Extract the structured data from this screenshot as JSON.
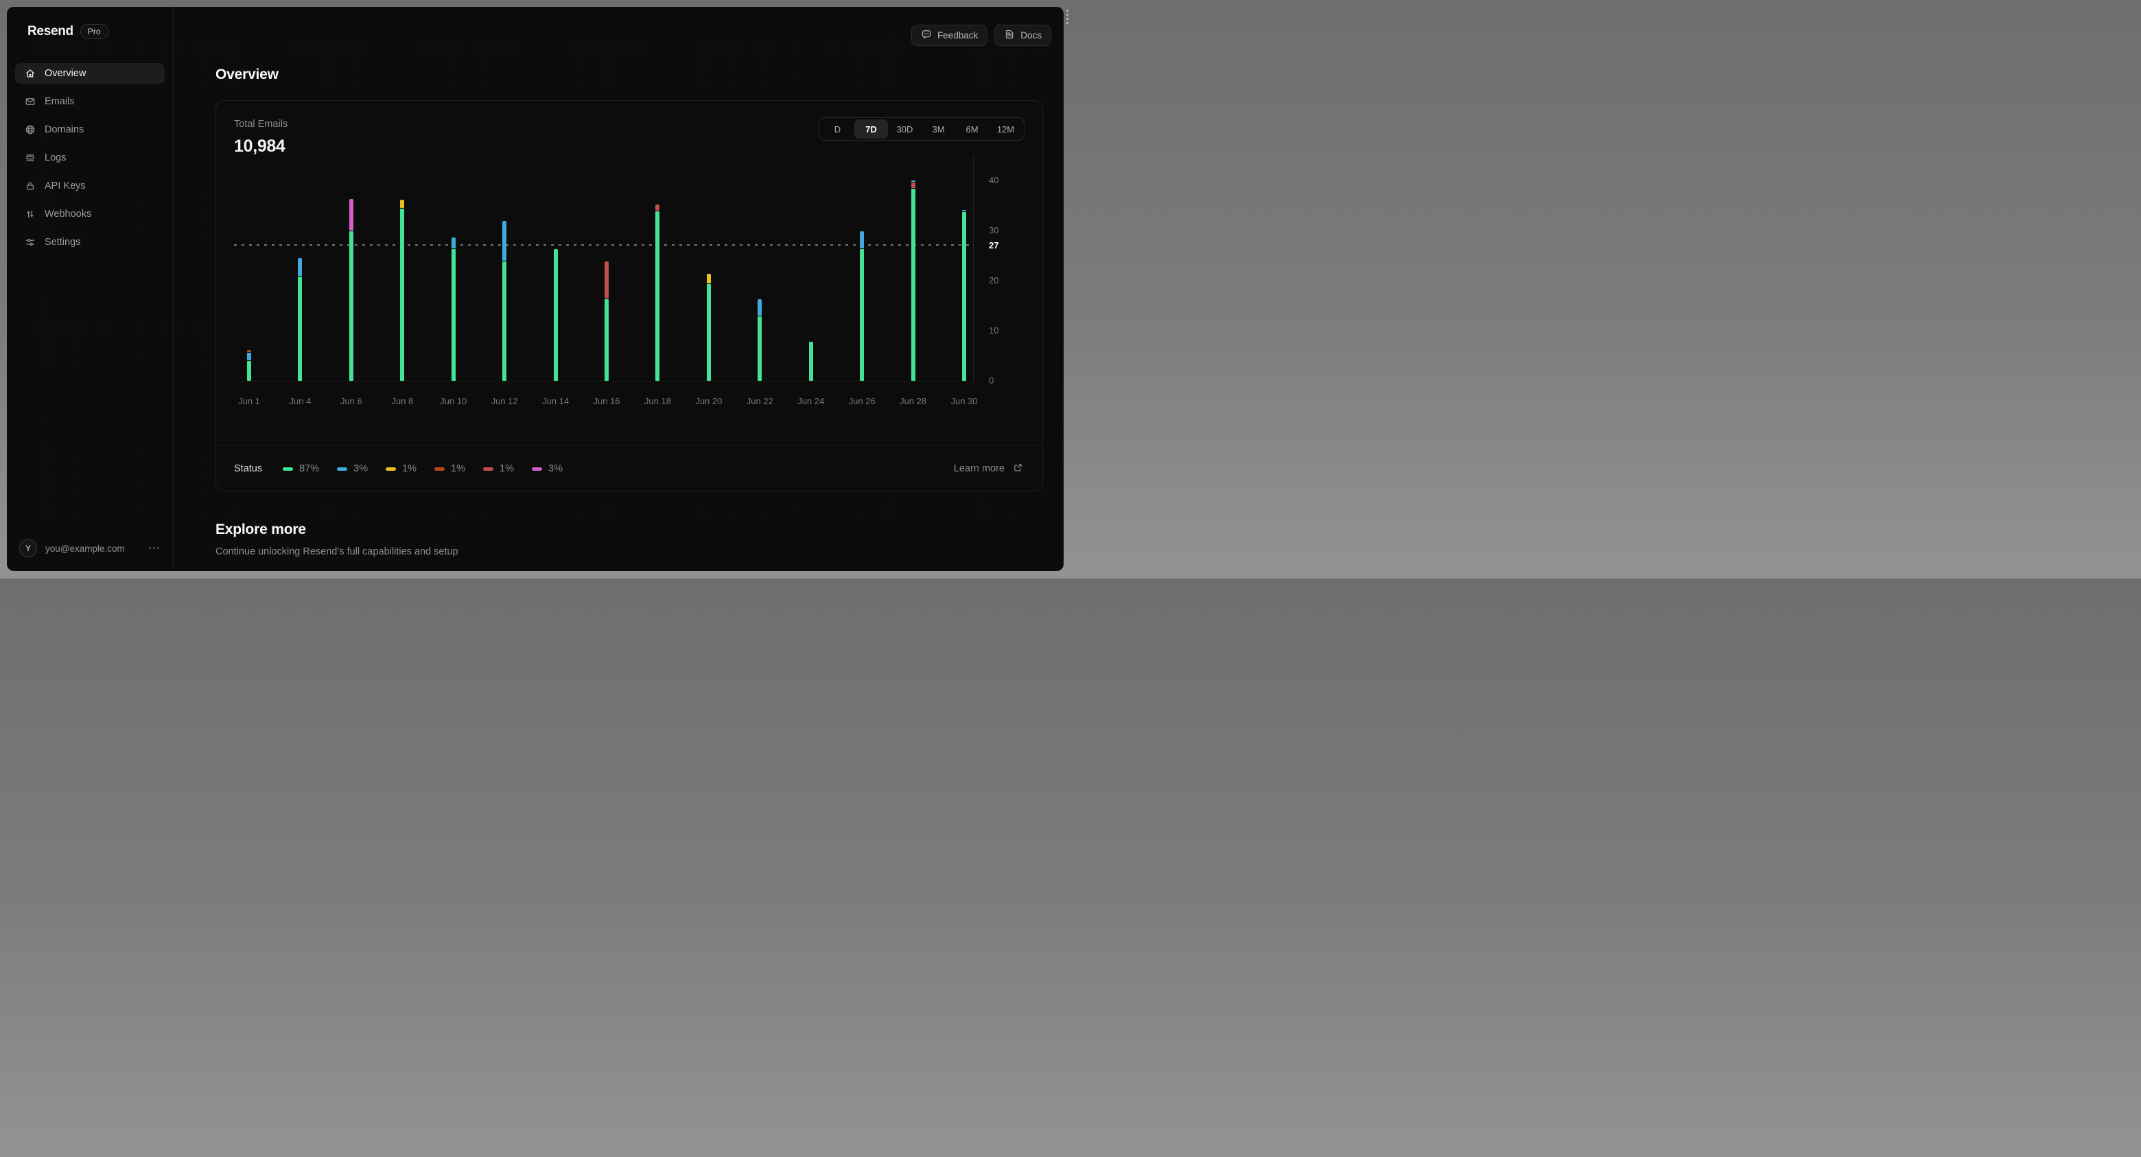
{
  "window": {
    "brand": "Resend",
    "plan_badge": "Pro"
  },
  "topbar": {
    "feedback_label": "Feedback",
    "docs_label": "Docs",
    "feedback_icon": "chat-bubble-icon",
    "docs_icon": "document-icon"
  },
  "sidebar": {
    "items": [
      {
        "label": "Overview",
        "icon": "home-icon",
        "active": true
      },
      {
        "label": "Emails",
        "icon": "mail-icon",
        "active": false
      },
      {
        "label": "Domains",
        "icon": "globe-icon",
        "active": false
      },
      {
        "label": "Logs",
        "icon": "logs-icon",
        "active": false
      },
      {
        "label": "API Keys",
        "icon": "lock-icon",
        "active": false
      },
      {
        "label": "Webhooks",
        "icon": "arrows-up-down-icon",
        "active": false
      },
      {
        "label": "Settings",
        "icon": "sliders-icon",
        "active": false
      }
    ],
    "user": {
      "avatar_initial": "Y",
      "email": "you@example.com",
      "menu_icon": "ellipsis-icon"
    }
  },
  "page": {
    "title": "Overview"
  },
  "card": {
    "metric_label": "Total Emails",
    "metric_value": "10,984",
    "ranges": [
      {
        "label": "D",
        "active": false
      },
      {
        "label": "7D",
        "active": true
      },
      {
        "label": "30D",
        "active": false
      },
      {
        "label": "3M",
        "active": false
      },
      {
        "label": "6M",
        "active": false
      },
      {
        "label": "12M",
        "active": false
      }
    ],
    "legend_title": "Status",
    "learn_more_label": "Learn more",
    "learn_more_icon": "external-link-icon"
  },
  "chart_data": {
    "type": "bar",
    "stacked": true,
    "title": "Total Emails",
    "categories": [
      "Jun 1",
      "Jun 4",
      "Jun 6",
      "Jun 8",
      "Jun 10",
      "Jun 12",
      "Jun 14",
      "Jun 16",
      "Jun 18",
      "Jun 20",
      "Jun 22",
      "Jun 24",
      "Jun 26",
      "Jun 28",
      "Jun 30"
    ],
    "series": [
      {
        "name": "delivered-green",
        "color": "#42e395",
        "values": [
          4.1,
          21,
          30,
          34.5,
          26.5,
          24,
          26.5,
          16.5,
          34,
          19.5,
          13,
          8,
          26.5,
          38.5,
          33.8
        ]
      },
      {
        "name": "yellow",
        "color": "#e9c21b",
        "values": [
          0,
          0,
          0,
          1.8,
          0,
          0,
          0,
          0,
          0,
          2,
          0,
          0,
          0,
          0,
          0
        ]
      },
      {
        "name": "magenta",
        "color": "#d45bc8",
        "values": [
          0,
          0,
          6.4,
          0,
          0,
          0,
          0,
          0,
          0,
          0,
          0,
          0,
          0,
          0,
          0
        ]
      },
      {
        "name": "red",
        "color": "#c05049",
        "values": [
          0,
          0,
          0,
          0,
          0,
          0,
          0,
          7.5,
          1.3,
          0,
          0,
          0,
          0,
          1.2,
          0
        ]
      },
      {
        "name": "blue",
        "color": "#43aadf",
        "values": [
          1.6,
          3.6,
          0,
          0,
          2.3,
          8,
          0,
          0,
          0,
          0,
          3.5,
          0,
          3.5,
          0.5,
          0.5
        ]
      },
      {
        "name": "orange-dotted",
        "color": "#b64722",
        "values": [
          0.6,
          0,
          0,
          0,
          0,
          0,
          0,
          0,
          0,
          0,
          0,
          0,
          0,
          0,
          0
        ]
      }
    ],
    "ylabel": "",
    "xlabel": "",
    "ylim": [
      0,
      41
    ],
    "yticks": [
      0,
      10,
      20,
      30,
      40
    ],
    "grid": false,
    "legend_position": "bottom",
    "average_line": {
      "value": 27,
      "label": "27"
    },
    "legend": [
      {
        "color": "#42e395",
        "percent": "87%"
      },
      {
        "color": "#43aadf",
        "percent": "3%"
      },
      {
        "color": "#e9c21b",
        "percent": "1%"
      },
      {
        "color": "#b64722",
        "percent": "1%",
        "pattern": "dotted"
      },
      {
        "color": "#c05049",
        "percent": "1%"
      },
      {
        "color": "#d45bc8",
        "percent": "3%"
      }
    ]
  },
  "explore": {
    "title": "Explore more",
    "subtitle": "Continue unlocking Resend’s full capabilities and setup"
  }
}
